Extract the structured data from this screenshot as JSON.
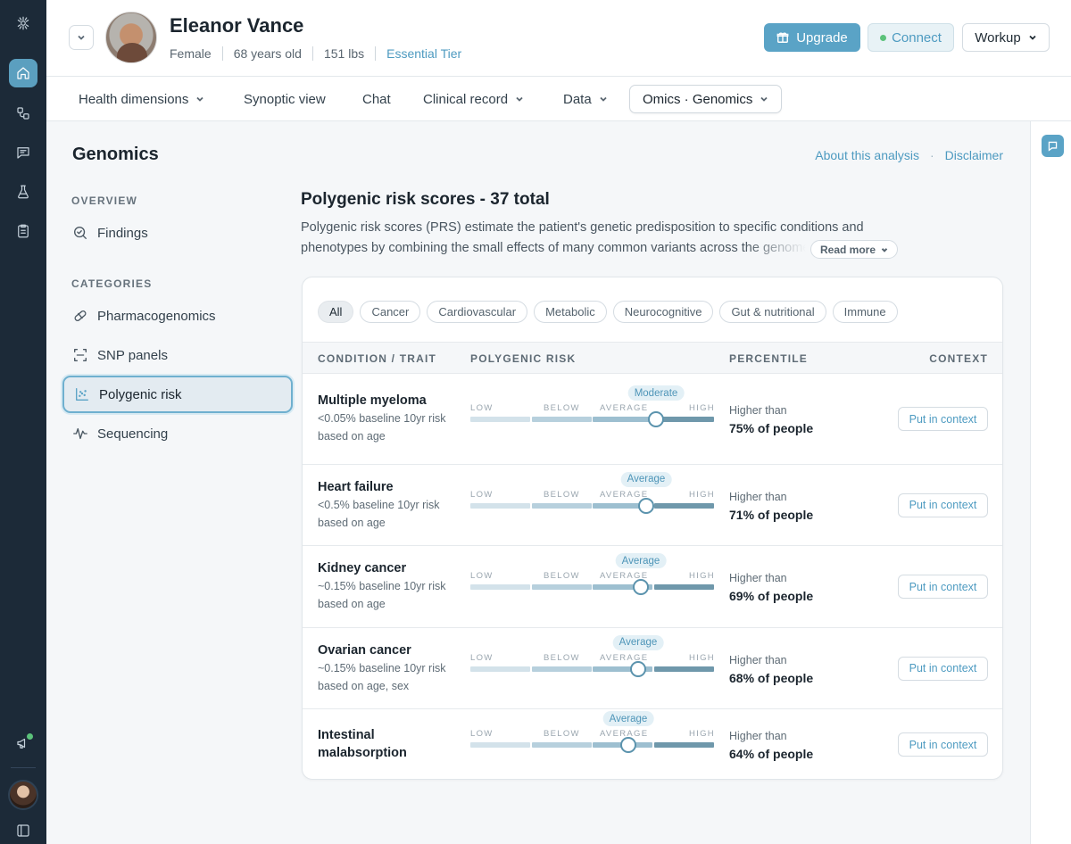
{
  "patient": {
    "name": "Eleanor Vance",
    "sex": "Female",
    "age": "68 years old",
    "weight": "151 lbs",
    "tier": "Essential Tier"
  },
  "header": {
    "upgrade_label": "Upgrade",
    "connect_label": "Connect",
    "workup_label": "Workup"
  },
  "nav": {
    "items": [
      {
        "label": "Health dimensions",
        "dropdown": true
      },
      {
        "label": "Synoptic view",
        "dropdown": false
      },
      {
        "label": "Chat",
        "dropdown": false
      },
      {
        "label": "Clinical record",
        "dropdown": true
      },
      {
        "label": "Data",
        "dropdown": true
      },
      {
        "label": "Omics · Genomics",
        "dropdown": true,
        "active": true
      }
    ]
  },
  "page": {
    "title": "Genomics",
    "about_link": "About this analysis",
    "separator": "·",
    "disclaimer_link": "Disclaimer"
  },
  "sidebar": {
    "overview_label": "OVERVIEW",
    "overview_items": [
      {
        "label": "Findings",
        "icon": "search-icon"
      }
    ],
    "categories_label": "CATEGORIES",
    "category_items": [
      {
        "label": "Pharmacogenomics",
        "icon": "pill-icon"
      },
      {
        "label": "SNP panels",
        "icon": "scan-icon"
      },
      {
        "label": "Polygenic risk",
        "icon": "scatter-icon",
        "active": true
      },
      {
        "label": "Sequencing",
        "icon": "waveform-icon"
      }
    ]
  },
  "prs": {
    "title": "Polygenic risk scores - 37 total",
    "description_line1": "Polygenic risk scores (PRS) estimate the patient's genetic predisposition to specific conditions and",
    "description_line2": "phenotypes by combining the small effects of many common variants across the genome",
    "read_more": "Read more"
  },
  "filters": [
    "All",
    "Cancer",
    "Cardiovascular",
    "Metabolic",
    "Neurocognitive",
    "Gut & nutritional",
    "Immune"
  ],
  "active_filter": "All",
  "table": {
    "headers": {
      "condition": "CONDITION / TRAIT",
      "risk": "POLYGENIC RISK",
      "percentile": "PERCENTILE",
      "context": "CONTEXT"
    },
    "scale_labels": [
      "LOW",
      "BELOW",
      "AVERAGE",
      "HIGH"
    ],
    "percentile_prefix": "Higher than",
    "context_button": "Put in context",
    "rows": [
      {
        "name": "Multiple myeloma",
        "baseline": "<0.05% baseline 10yr risk",
        "basis": "based on age",
        "risk_label": "Moderate",
        "percentile": "75% of people",
        "percentile_value": 75
      },
      {
        "name": "Heart failure",
        "baseline": "<0.5% baseline 10yr risk",
        "basis": "based on age",
        "risk_label": "Average",
        "percentile": "71% of people",
        "percentile_value": 71
      },
      {
        "name": "Kidney cancer",
        "baseline": "~0.15% baseline 10yr risk",
        "basis": "based on age",
        "risk_label": "Average",
        "percentile": "69% of people",
        "percentile_value": 69
      },
      {
        "name": "Ovarian cancer",
        "baseline": "~0.15% baseline 10yr risk",
        "basis": "based on age, sex",
        "risk_label": "Average",
        "percentile": "68% of people",
        "percentile_value": 68
      },
      {
        "name": "Intestinal malabsorption",
        "baseline": "",
        "basis": "",
        "risk_label": "Average",
        "percentile": "64% of people",
        "percentile_value": 64
      }
    ]
  },
  "colors": {
    "accent": "#5aa3c6",
    "rail_bg": "#1c2a38",
    "scale": [
      "#d3e2ea",
      "#b7d0dd",
      "#9dbfd0",
      "#6f98ab"
    ]
  }
}
